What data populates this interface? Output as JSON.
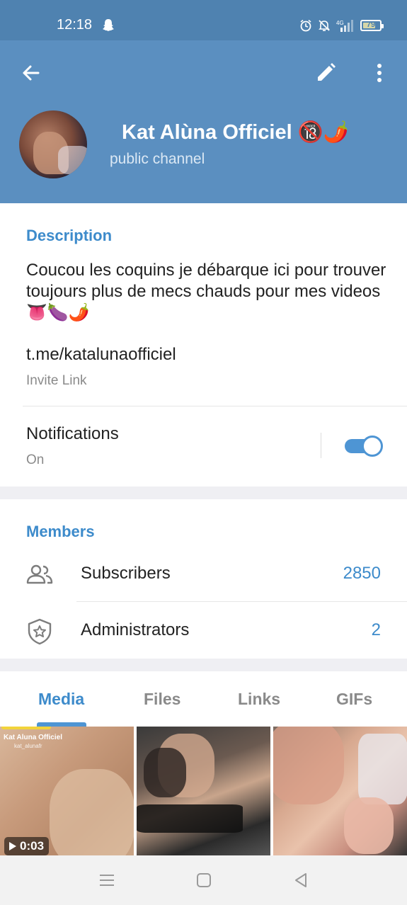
{
  "status_bar": {
    "time": "12:18",
    "network": "4G",
    "battery_level": 79,
    "battery_label": "79",
    "icons": [
      "snapchat-icon",
      "alarm-icon",
      "mute-icon",
      "signal-icon",
      "battery-icon"
    ]
  },
  "header": {
    "channel_name": "Kat Alùna Officiel 🔞🌶️",
    "channel_type": "public channel",
    "icons": [
      "back-arrow-icon",
      "pencil-icon",
      "more-vertical-icon"
    ]
  },
  "description": {
    "title": "Description",
    "text": "Coucou les coquins je débarque ici pour trouver toujours plus de mecs chauds pour mes videos 👅🍆🌶️",
    "link": "t.me/katalunaofficiel",
    "link_label": "Invite Link"
  },
  "notifications": {
    "label": "Notifications",
    "status": "On",
    "enabled": true
  },
  "members": {
    "title": "Members",
    "rows": [
      {
        "label": "Subscribers",
        "value": "2850",
        "icon": "people-icon"
      },
      {
        "label": "Administrators",
        "value": "2",
        "icon": "shield-star-icon"
      }
    ]
  },
  "tabs": [
    {
      "label": "Media",
      "active": true
    },
    {
      "label": "Files",
      "active": false
    },
    {
      "label": "Links",
      "active": false
    },
    {
      "label": "GIFs",
      "active": false
    }
  ],
  "media": {
    "items": [
      {
        "caption_title": "Kat Aluna Officiel",
        "caption_user": "kat_alunafr",
        "duration": "0:03",
        "type": "video"
      },
      {
        "type": "photo"
      },
      {
        "type": "photo"
      }
    ]
  },
  "colors": {
    "header_bg": "#5b8fc0",
    "status_bg": "#4f82b0",
    "accent": "#3d8bcb"
  }
}
